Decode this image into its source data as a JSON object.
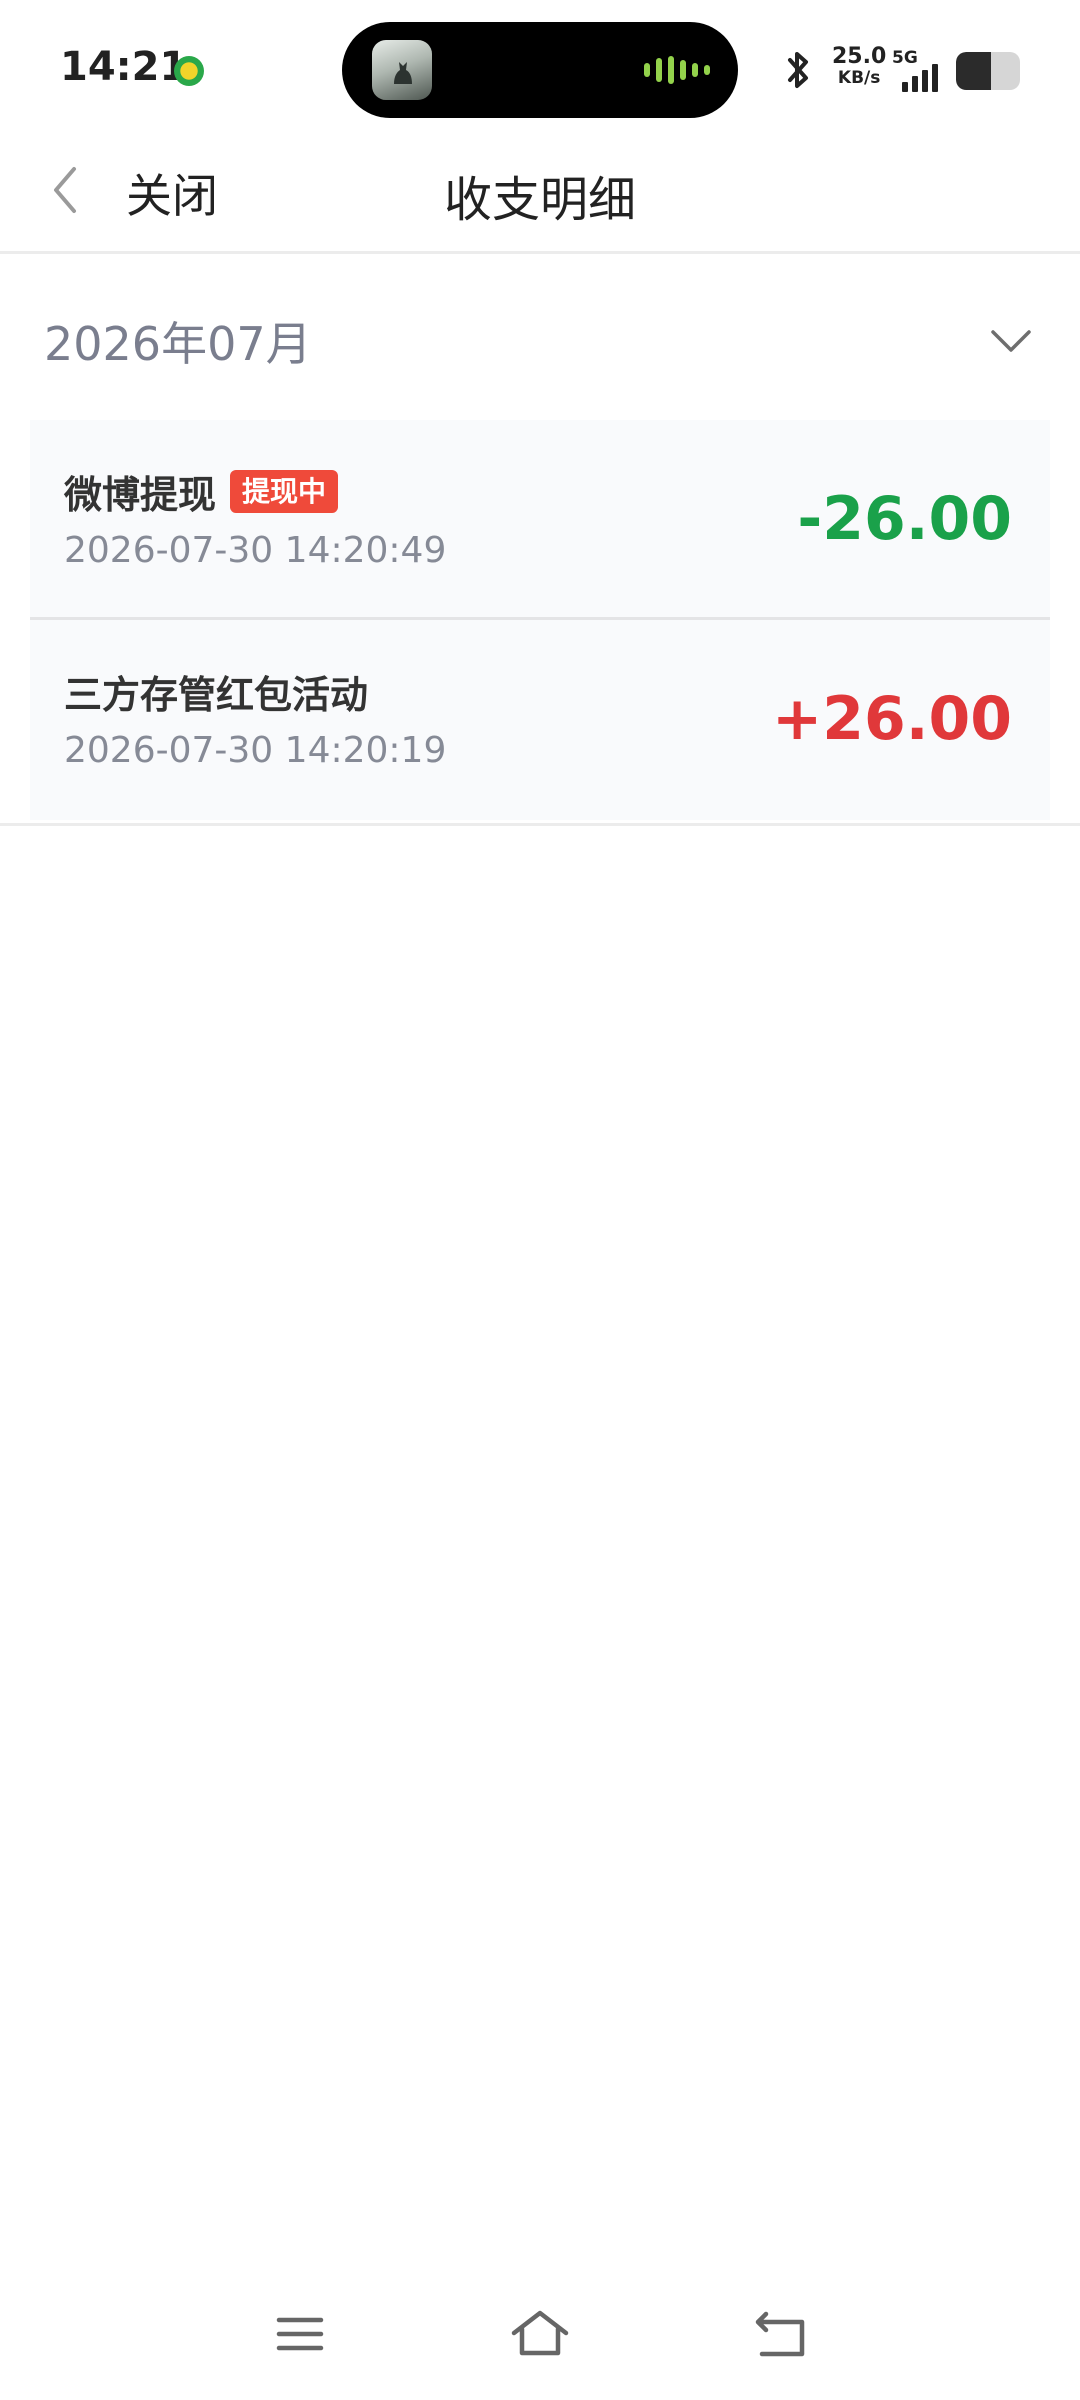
{
  "status_bar": {
    "time": "14:21",
    "net_speed_value": "25.0",
    "net_speed_unit": "KB/s",
    "network_type": "5G",
    "signal_bars": 4,
    "battery_level": 0.55
  },
  "header": {
    "close_label": "关闭",
    "title": "收支明细"
  },
  "filter": {
    "month": "2026年07月"
  },
  "transactions": [
    {
      "title": "微博提现",
      "badge": "提现中",
      "time": "2026-07-30 14:20:49",
      "amount": "-26.00",
      "color": "#1aa14a"
    },
    {
      "title": "三方存管红包活动",
      "time": "2026-07-30 14:20:19",
      "amount": "+26.00",
      "color": "#e0383a"
    }
  ],
  "nav_icons": [
    "menu-icon",
    "home-icon",
    "back-icon"
  ]
}
